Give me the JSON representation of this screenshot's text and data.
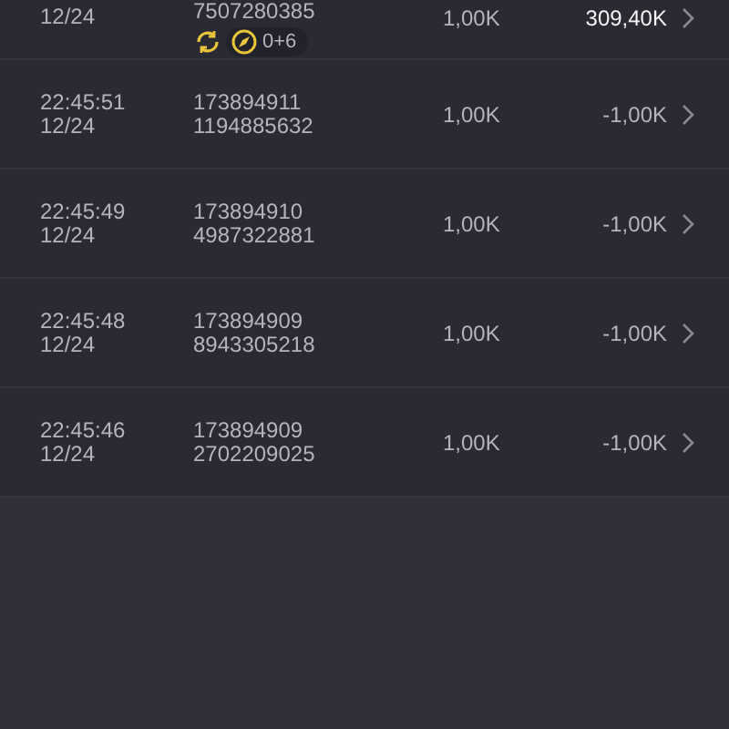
{
  "rows": [
    {
      "kind": "partial",
      "date": "12/24",
      "id": "7507280385",
      "badge": "0+6",
      "amount": "1,00K",
      "value": "309,40K"
    },
    {
      "kind": "full",
      "time": "22:45:51",
      "date": "12/24",
      "id": "173894911",
      "sub_id": "1194885632",
      "amount": "1,00K",
      "value": "-1,00K"
    },
    {
      "kind": "full",
      "time": "22:45:49",
      "date": "12/24",
      "id": "173894910",
      "sub_id": "4987322881",
      "amount": "1,00K",
      "value": "-1,00K"
    },
    {
      "kind": "full",
      "time": "22:45:48",
      "date": "12/24",
      "id": "173894909",
      "sub_id": "8943305218",
      "amount": "1,00K",
      "value": "-1,00K"
    },
    {
      "kind": "full",
      "time": "22:45:46",
      "date": "12/24",
      "id": "173894909",
      "sub_id": "2702209025",
      "amount": "1,00K",
      "value": "-1,00K"
    }
  ]
}
